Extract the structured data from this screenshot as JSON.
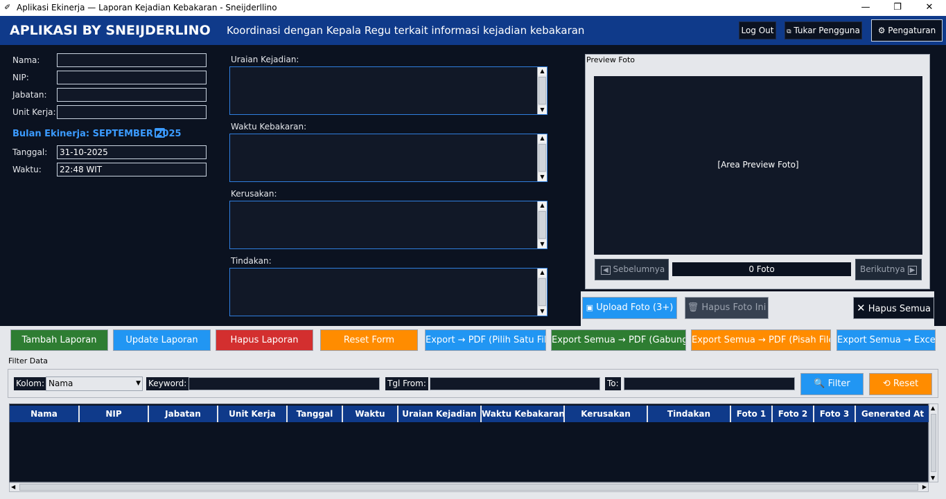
{
  "window": {
    "title": "Aplikasi Ekinerja — Laporan Kejadian Kebakaran - Sneijderllino"
  },
  "header": {
    "brand": "APLIKASI BY SNEIJDERLINO",
    "subtitle": "Koordinasi dengan Kepala Regu terkait informasi kejadian kebakaran",
    "logout_label": "Log Out",
    "switch_user_label": "Tukar Pengguna",
    "settings_label": "Pengaturan"
  },
  "form": {
    "nama_label": "Nama:",
    "nama_value": "",
    "nip_label": "NIP:",
    "nip_value": "",
    "jabatan_label": "Jabatan:",
    "jabatan_value": "",
    "unit_label": "Unit Kerja:",
    "unit_value": "",
    "month_label": "Bulan Ekinerja: SEPTEMBER 2025",
    "tanggal_label": "Tanggal:",
    "tanggal_value": "31-10-2025",
    "waktu_label": "Waktu:",
    "waktu_value": "22:48 WIT"
  },
  "details": {
    "uraian_label": "Uraian Kejadian:",
    "waktu_kebakaran_label": "Waktu Kebakaran:",
    "kerusakan_label": "Kerusakan:",
    "tindakan_label": "Tindakan:"
  },
  "preview": {
    "frame_label": "Preview Foto",
    "placeholder": "[Area Preview Foto]",
    "prev_label": "Sebelumnya",
    "next_label": "Berikutnya",
    "count_text": "0 Foto",
    "upload_label": "Upload Foto (3+)",
    "delete_one_label": "Hapus Foto Ini",
    "delete_all_label": "Hapus Semua"
  },
  "actions": {
    "add": "Tambah Laporan",
    "update": "Update Laporan",
    "delete": "Hapus Laporan",
    "reset_form": "Reset Form",
    "export_pdf_one": "Export → PDF (Pilih Satu File",
    "export_all_pdf_merge": "Export Semua → PDF (Gabung)",
    "export_all_pdf_split": "Export Semua → PDF (Pisah File)",
    "export_all_excel": "Export Semua → Excel"
  },
  "filter": {
    "title": "Filter Data",
    "column_label": "Kolom:",
    "column_value": "Nama",
    "keyword_label": "Keyword:",
    "date_from_label": "Tgl From:",
    "to_label": "To:",
    "filter_button": "Filter",
    "reset_button": "Reset"
  },
  "table": {
    "columns": [
      "Nama",
      "NIP",
      "Jabatan",
      "Unit Kerja",
      "Tanggal",
      "Waktu",
      "Uraian Kejadian",
      "Waktu Kebakaran",
      "Kerusakan",
      "Tindakan",
      "Foto 1",
      "Foto 2",
      "Foto 3",
      "Generated At"
    ],
    "rows": []
  },
  "colors": {
    "header_bg": "#0f3a8a",
    "main_bg": "#0b1220",
    "green": "#2e7d32",
    "blue": "#2196f3",
    "red": "#d32f2f",
    "orange": "#ff8c00"
  }
}
